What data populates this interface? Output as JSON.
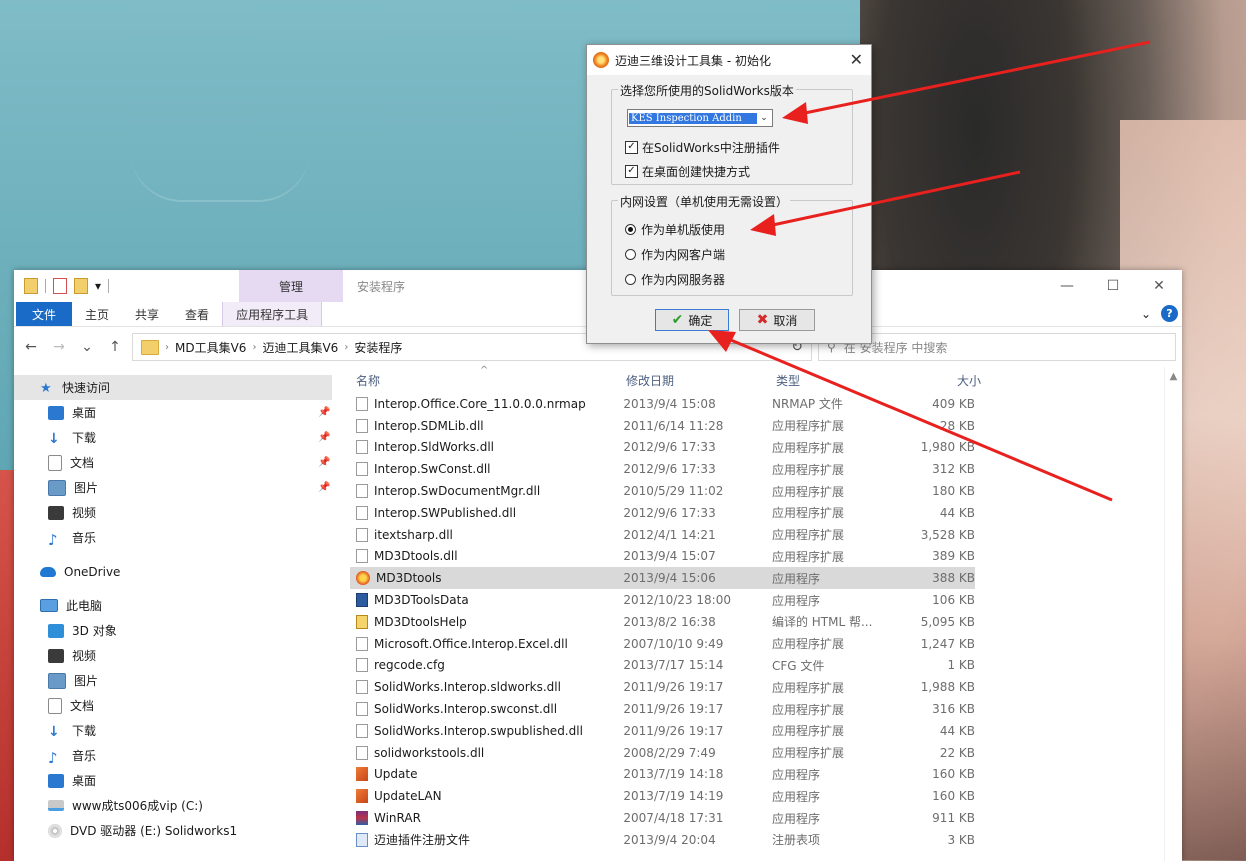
{
  "explorer": {
    "qat_sep": "▾",
    "manage_tab": "管理",
    "title": "安装程序",
    "win_min": "—",
    "win_max": "☐",
    "win_close": "✕",
    "ribbon": {
      "file": "文件",
      "home": "主页",
      "share": "共享",
      "view": "查看",
      "app_tools": "应用程序工具"
    },
    "expand": "⌄",
    "help": "?",
    "nav": {
      "back": "←",
      "forward": "→",
      "recent": "⌄",
      "up": "↑"
    },
    "breadcrumb": [
      "MD工具集V6",
      "迈迪工具集V6",
      "安装程序"
    ],
    "crumb_sep": "›",
    "refresh": "↻",
    "search_icon": "⚲",
    "search_placeholder": "在 安装程序 中搜索",
    "columns": {
      "name": "名称",
      "date": "修改日期",
      "type": "类型",
      "size": "大小"
    },
    "sort_glyph": "^",
    "sidebar": {
      "quick_access": "快速访问",
      "qa_items": [
        "桌面",
        "下载",
        "文档",
        "图片",
        "视频",
        "音乐"
      ],
      "onedrive": "OneDrive",
      "this_pc": "此电脑",
      "pc_items": [
        "3D 对象",
        "视频",
        "图片",
        "文档",
        "下载",
        "音乐",
        "桌面"
      ],
      "drive_c": "www成ts006成vip (C:)",
      "drive_e": "DVD 驱动器 (E:) Solidworks1"
    },
    "files": [
      {
        "name": "Interop.Office.Core_11.0.0.0.nrmap",
        "date": "2013/9/4 15:08",
        "type": "NRMAP 文件",
        "size": "409 KB"
      },
      {
        "name": "Interop.SDMLib.dll",
        "date": "2011/6/14 11:28",
        "type": "应用程序扩展",
        "size": "28 KB"
      },
      {
        "name": "Interop.SldWorks.dll",
        "date": "2012/9/6 17:33",
        "type": "应用程序扩展",
        "size": "1,980 KB"
      },
      {
        "name": "Interop.SwConst.dll",
        "date": "2012/9/6 17:33",
        "type": "应用程序扩展",
        "size": "312 KB"
      },
      {
        "name": "Interop.SwDocumentMgr.dll",
        "date": "2010/5/29 11:02",
        "type": "应用程序扩展",
        "size": "180 KB"
      },
      {
        "name": "Interop.SWPublished.dll",
        "date": "2012/9/6 17:33",
        "type": "应用程序扩展",
        "size": "44 KB"
      },
      {
        "name": "itextsharp.dll",
        "date": "2012/4/1 14:21",
        "type": "应用程序扩展",
        "size": "3,528 KB"
      },
      {
        "name": "MD3Dtools.dll",
        "date": "2013/9/4 15:07",
        "type": "应用程序扩展",
        "size": "389 KB"
      },
      {
        "name": "MD3Dtools",
        "date": "2013/9/4 15:06",
        "type": "应用程序",
        "size": "388 KB"
      },
      {
        "name": "MD3DToolsData",
        "date": "2012/10/23 18:00",
        "type": "应用程序",
        "size": "106 KB"
      },
      {
        "name": "MD3DtoolsHelp",
        "date": "2013/8/2 16:38",
        "type": "编译的 HTML 帮...",
        "size": "5,095 KB"
      },
      {
        "name": "Microsoft.Office.Interop.Excel.dll",
        "date": "2007/10/10 9:49",
        "type": "应用程序扩展",
        "size": "1,247 KB"
      },
      {
        "name": "regcode.cfg",
        "date": "2013/7/17 15:14",
        "type": "CFG 文件",
        "size": "1 KB"
      },
      {
        "name": "SolidWorks.Interop.sldworks.dll",
        "date": "2011/9/26 19:17",
        "type": "应用程序扩展",
        "size": "1,988 KB"
      },
      {
        "name": "SolidWorks.Interop.swconst.dll",
        "date": "2011/9/26 19:17",
        "type": "应用程序扩展",
        "size": "316 KB"
      },
      {
        "name": "SolidWorks.Interop.swpublished.dll",
        "date": "2011/9/26 19:17",
        "type": "应用程序扩展",
        "size": "44 KB"
      },
      {
        "name": "solidworkstools.dll",
        "date": "2008/2/29 7:49",
        "type": "应用程序扩展",
        "size": "22 KB"
      },
      {
        "name": "Update",
        "date": "2013/7/19 14:18",
        "type": "应用程序",
        "size": "160 KB"
      },
      {
        "name": "UpdateLAN",
        "date": "2013/7/19 14:19",
        "type": "应用程序",
        "size": "160 KB"
      },
      {
        "name": "WinRAR",
        "date": "2007/4/18 17:31",
        "type": "应用程序",
        "size": "911 KB"
      },
      {
        "name": "迈迪插件注册文件",
        "date": "2013/9/4 20:04",
        "type": "注册表项",
        "size": "3 KB"
      }
    ]
  },
  "dialog": {
    "title": "迈迪三维设计工具集 - 初始化",
    "close": "✕",
    "version_group": "选择您所使用的SolidWorks版本",
    "version_selected": "KES Inspection Addin",
    "combo_arrow": "⌄",
    "check_mark": "✓",
    "register_plugin": "在SolidWorks中注册插件",
    "desktop_shortcut": "在桌面创建快捷方式",
    "lan_group": "内网设置（单机使用无需设置）",
    "radio_standalone": "作为单机版使用",
    "radio_client": "作为内网客户端",
    "radio_server": "作为内网服务器",
    "ok": "确定",
    "cancel": "取消",
    "ok_glyph": "✔",
    "cancel_glyph": "✖"
  },
  "colors": {
    "arrow": "#e8201e",
    "accent": "#1a6bc8"
  }
}
